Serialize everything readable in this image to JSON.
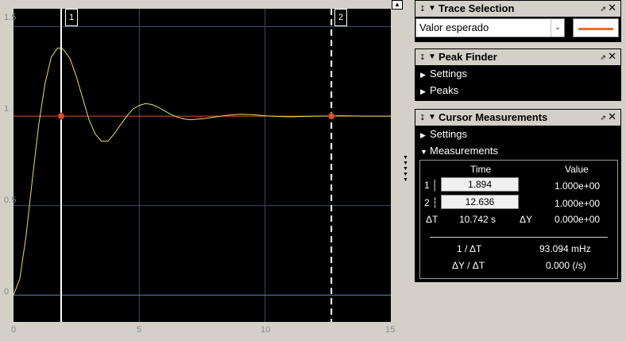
{
  "plot": {
    "x_ticks": [
      "0",
      "5",
      "10",
      "15"
    ],
    "y_ticks": [
      "1.5",
      "1",
      "0.5",
      "0"
    ],
    "cursors": [
      {
        "label": "1",
        "time": 1.894,
        "style": "solid"
      },
      {
        "label": "2",
        "time": 12.636,
        "style": "dashed"
      }
    ],
    "reference_level": 1.0,
    "colors": {
      "background": "#000000",
      "grid": "#3c4a6c",
      "trace": "#e8e05a",
      "reference": "#e05030",
      "zero": "#5a86c8",
      "cursor": "#ffffff"
    }
  },
  "chart_data": {
    "type": "line",
    "x": [
      0,
      0.25,
      0.5,
      0.75,
      1.0,
      1.25,
      1.5,
      1.75,
      1.894,
      2.0,
      2.25,
      2.5,
      2.75,
      3.0,
      3.25,
      3.5,
      3.75,
      4.0,
      4.25,
      4.5,
      4.75,
      5.0,
      5.25,
      5.5,
      5.75,
      6.0,
      6.25,
      6.5,
      6.75,
      7.0,
      7.5,
      8.0,
      8.5,
      9.0,
      9.5,
      10.0,
      10.5,
      11.0,
      11.5,
      12.0,
      12.5,
      13.0,
      13.5,
      14.0,
      14.5,
      15.0
    ],
    "series": [
      {
        "values": [
          0,
          0.09,
          0.33,
          0.65,
          0.95,
          1.18,
          1.33,
          1.38,
          1.38,
          1.37,
          1.32,
          1.22,
          1.1,
          0.98,
          0.9,
          0.86,
          0.86,
          0.9,
          0.95,
          1.0,
          1.04,
          1.06,
          1.07,
          1.065,
          1.05,
          1.03,
          1.01,
          0.995,
          0.985,
          0.98,
          0.985,
          0.995,
          1.005,
          1.01,
          1.008,
          1.002,
          0.998,
          0.996,
          0.998,
          1.0,
          1.001,
          1.002,
          1.001,
          1.0,
          1.0,
          1.0
        ]
      }
    ],
    "xlim": [
      0,
      15
    ],
    "ylim": [
      -0.15,
      1.6
    ]
  },
  "trace_selection": {
    "title": "Trace Selection",
    "selected": "Valor esperado",
    "line_color": "#f06a28"
  },
  "peak_finder": {
    "title": "Peak Finder",
    "items": [
      "Settings",
      "Peaks"
    ]
  },
  "cursor_measurements": {
    "title": "Cursor Measurements",
    "items": [
      "Settings",
      "Measurements"
    ],
    "col_time": "Time",
    "col_value": "Value",
    "rows": [
      {
        "label": "1",
        "time": "1.894",
        "value": "1.000e+00"
      },
      {
        "label": "2",
        "time": "12.636",
        "value": "1.000e+00"
      }
    ],
    "delta_t_label": "ΔT",
    "delta_t_value": "10.742 s",
    "delta_y_label": "ΔY",
    "delta_y_value": "0.000e+00",
    "inv_dt_label": "1 / ΔT",
    "inv_dt_value": "93.094 mHz",
    "dy_dt_label": "ΔY / ΔT",
    "dy_dt_value": "0.000 (/s)"
  }
}
